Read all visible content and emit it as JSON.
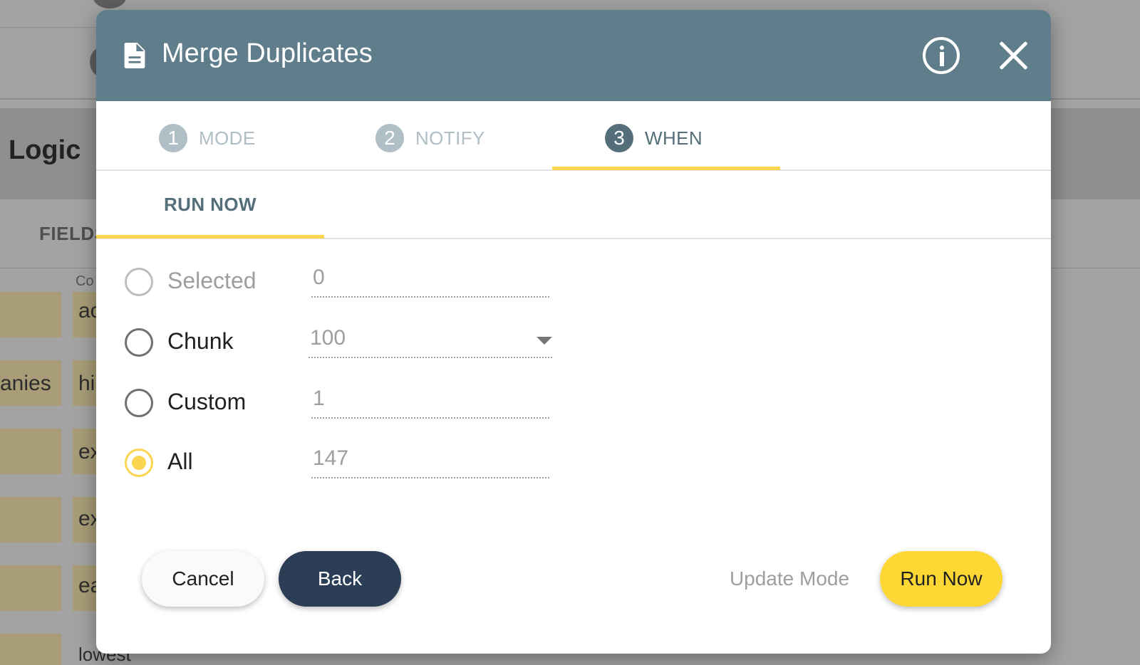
{
  "background": {
    "logic_title": "Logic",
    "fields_tab": "FIELDS",
    "column_header_fragment": "Co",
    "row_words": [
      "ac",
      "hi",
      "ex",
      "ex",
      "ea",
      "lowest"
    ],
    "row_left_fragment": "anies"
  },
  "dialog": {
    "title": "Merge Duplicates",
    "icons": {
      "title_icon": "document-icon",
      "info": "info-icon",
      "close": "close-icon"
    },
    "steps": [
      {
        "number": "1",
        "label": "MODE",
        "active": false
      },
      {
        "number": "2",
        "label": "NOTIFY",
        "active": false
      },
      {
        "number": "3",
        "label": "WHEN",
        "active": true
      }
    ],
    "subtab": "RUN NOW",
    "options": [
      {
        "label": "Selected",
        "value": "0",
        "disabled": true,
        "checked": false
      },
      {
        "label": "Chunk",
        "value": "100",
        "disabled": false,
        "checked": false,
        "is_select": true
      },
      {
        "label": "Custom",
        "value": "1",
        "disabled": false,
        "checked": false
      },
      {
        "label": "All",
        "value": "147",
        "disabled": false,
        "checked": true
      }
    ],
    "buttons": {
      "cancel": "Cancel",
      "back": "Back",
      "update_mode": "Update Mode",
      "run_now": "Run Now"
    }
  },
  "colors": {
    "header": "#607d8b",
    "accent": "#fdd835",
    "step_active": "#546e7a",
    "back_button": "#2c3e55"
  }
}
